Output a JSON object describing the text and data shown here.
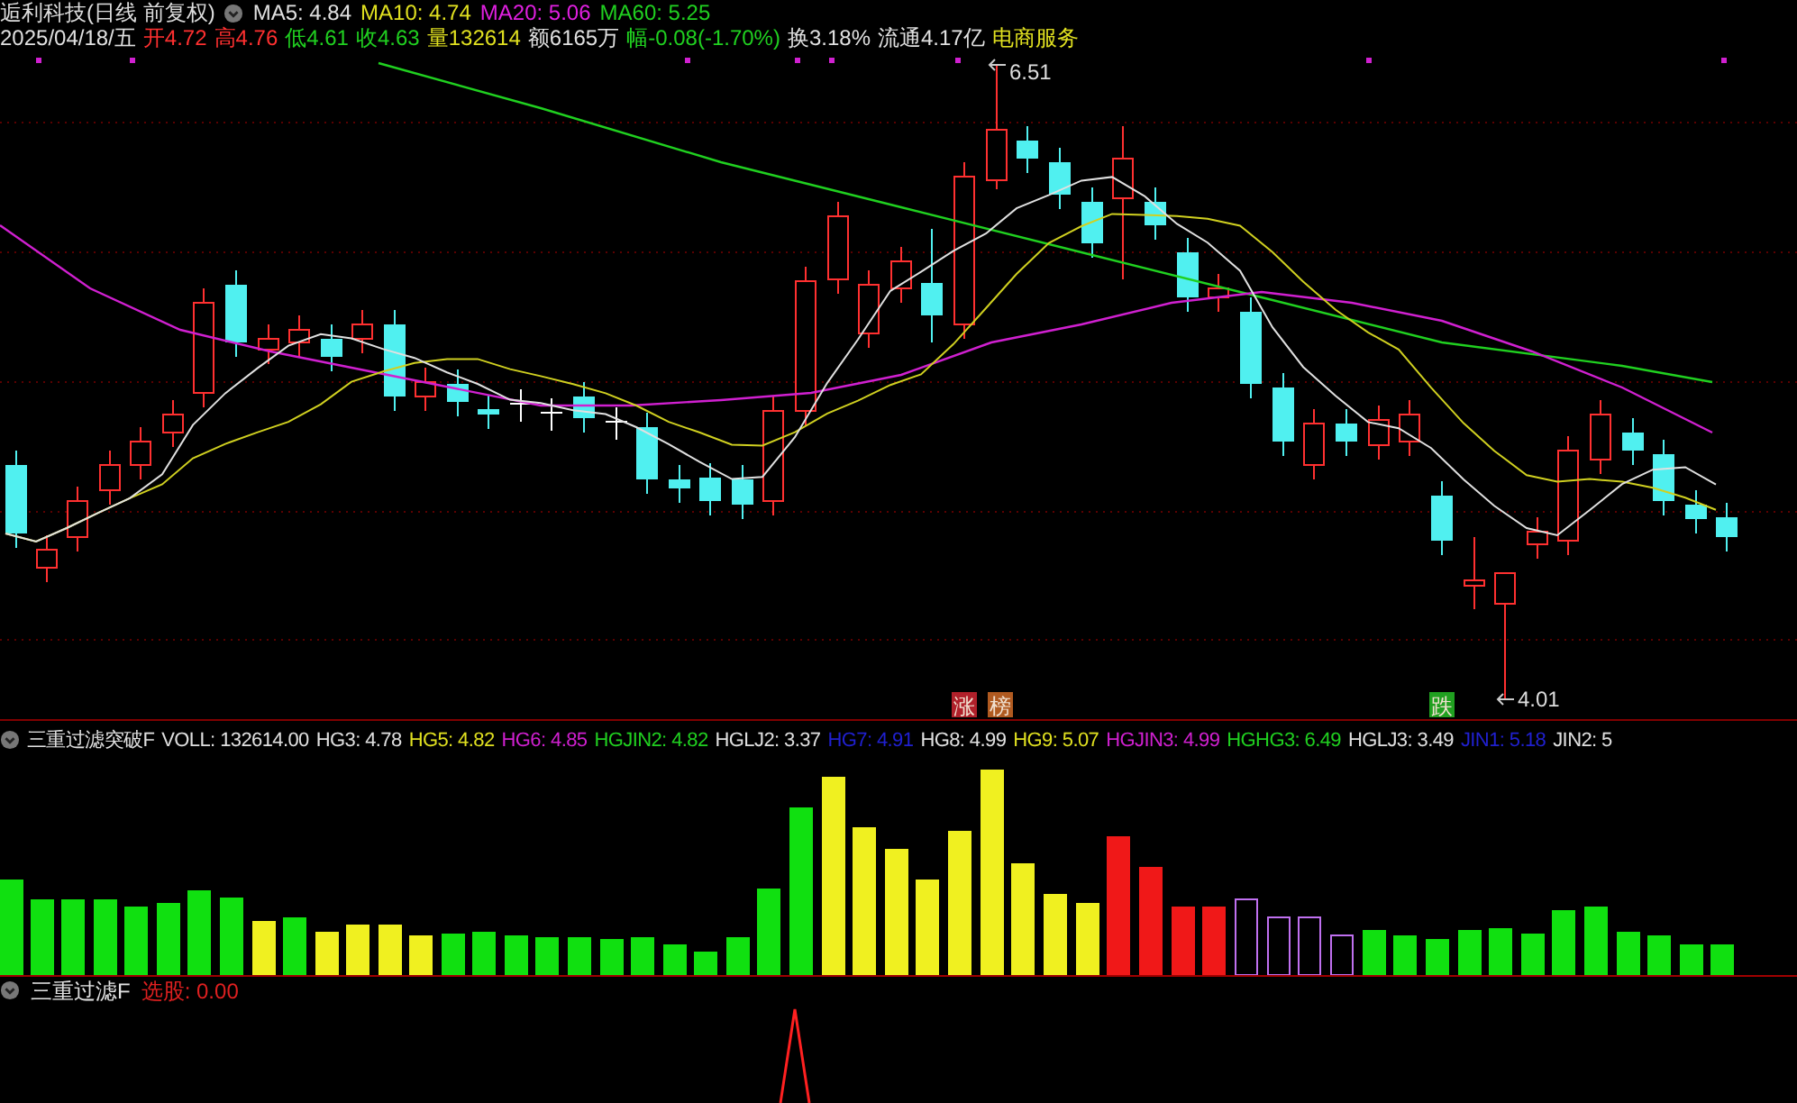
{
  "header": {
    "title": "逅利科技(日线 前复权)",
    "ma": [
      {
        "text": "MA5: 4.84",
        "color": "#e0e0e0"
      },
      {
        "text": "MA10: 4.74",
        "color": "#e0e020"
      },
      {
        "text": "MA20: 5.06",
        "color": "#e020e0"
      },
      {
        "text": "MA60: 5.25",
        "color": "#20d020"
      }
    ]
  },
  "quote": [
    {
      "text": "2025/04/18/五",
      "color": "#e0e0e0"
    },
    {
      "text": "开4.72",
      "color": "#ff3030"
    },
    {
      "text": "高4.76",
      "color": "#ff3030"
    },
    {
      "text": "低4.61",
      "color": "#20d020"
    },
    {
      "text": "收4.63",
      "color": "#20d020"
    },
    {
      "text": "量132614",
      "color": "#e0e020"
    },
    {
      "text": "额6165万",
      "color": "#e0e0e0"
    },
    {
      "text": "幅-0.08(-1.70%)",
      "color": "#20d020"
    },
    {
      "text": "换3.18%",
      "color": "#e0e0e0"
    },
    {
      "text": "流通4.17亿",
      "color": "#e0e0e0"
    },
    {
      "text": "电商服务",
      "color": "#e0e020"
    }
  ],
  "price_marks": [
    {
      "text": "6.51",
      "kind": "high"
    },
    {
      "text": "4.01",
      "kind": "low"
    }
  ],
  "badges": [
    {
      "text": "涨",
      "color": "#b0202a"
    },
    {
      "text": "榜",
      "color": "#b05a20"
    },
    {
      "text": "跌",
      "color": "#20a020"
    }
  ],
  "indicator": {
    "title": "三重过滤突破F",
    "values": [
      {
        "text": "VOLL: 132614.00",
        "color": "#e0e0e0"
      },
      {
        "text": "HG3: 4.78",
        "color": "#e0e0e0"
      },
      {
        "text": "HG5: 4.82",
        "color": "#e0e020"
      },
      {
        "text": "HG6: 4.85",
        "color": "#d020d0"
      },
      {
        "text": "HGJIN2: 4.82",
        "color": "#20d020"
      },
      {
        "text": "HGLJ2: 3.37",
        "color": "#e0e0e0"
      },
      {
        "text": "HG7: 4.91",
        "color": "#2020d0"
      },
      {
        "text": "HG8: 4.99",
        "color": "#e0e0e0"
      },
      {
        "text": "HG9: 5.07",
        "color": "#e0e020"
      },
      {
        "text": "HGJIN3: 4.99",
        "color": "#d020d0"
      },
      {
        "text": "HGHG3: 6.49",
        "color": "#20d020"
      },
      {
        "text": "HGLJ3: 3.49",
        "color": "#e0e0e0"
      },
      {
        "text": "JIN1: 5.18",
        "color": "#2020d0"
      },
      {
        "text": "JIN2: 5",
        "color": "#e0e0e0"
      }
    ]
  },
  "filter": {
    "title": "三重过滤F",
    "values": [
      {
        "text": "选股: 0.00",
        "color": "#e02020"
      }
    ]
  }
}
